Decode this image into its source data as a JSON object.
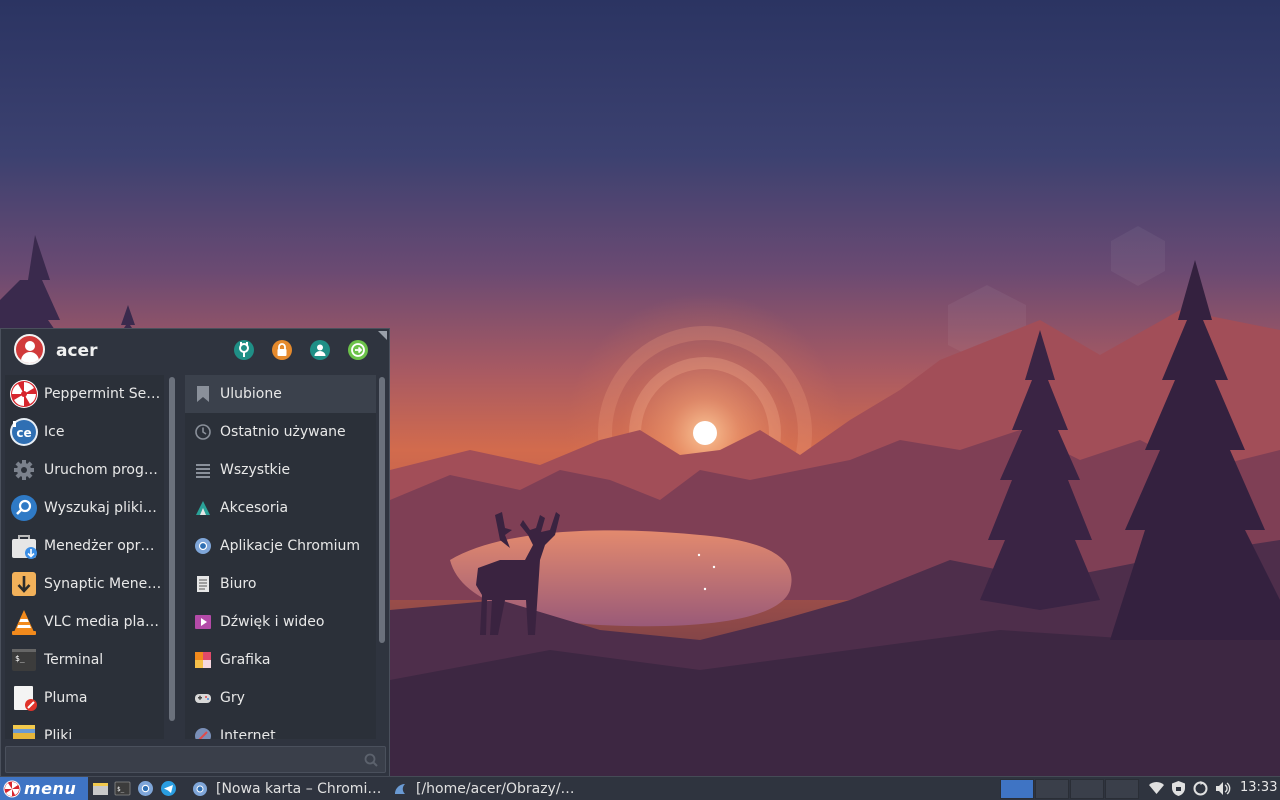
{
  "user": {
    "name": "acer"
  },
  "header_buttons": [
    {
      "name": "settings",
      "icon": "control-center-icon",
      "color": "#2aa198"
    },
    {
      "name": "lock",
      "icon": "lock-icon",
      "color": "#e58a2d"
    },
    {
      "name": "user-switch",
      "icon": "user-switch-icon",
      "color": "#2aa198"
    },
    {
      "name": "logout",
      "icon": "logout-icon",
      "color": "#6cc24a"
    }
  ],
  "favorites": [
    {
      "label": "Peppermint Se…",
      "icon": "peppermint-icon"
    },
    {
      "label": "Ice",
      "icon": "ice-icon"
    },
    {
      "label": "Uruchom prog…",
      "icon": "gear-icon"
    },
    {
      "label": "Wyszukaj pliki…",
      "icon": "search-files-icon"
    },
    {
      "label": "Menedżer opr…",
      "icon": "software-manager-icon"
    },
    {
      "label": "Synaptic Mene…",
      "icon": "synaptic-icon"
    },
    {
      "label": "VLC media player",
      "icon": "vlc-icon"
    },
    {
      "label": "Terminal",
      "icon": "terminal-icon"
    },
    {
      "label": "Pluma",
      "icon": "text-editor-icon"
    },
    {
      "label": "Pliki",
      "icon": "file-manager-icon"
    }
  ],
  "categories": [
    {
      "label": "Ulubione",
      "icon": "bookmark-icon",
      "selected": true
    },
    {
      "label": "Ostatnio używane",
      "icon": "clock-icon",
      "selected": false
    },
    {
      "label": "Wszystkie",
      "icon": "list-icon",
      "selected": false
    },
    {
      "label": "Akcesoria",
      "icon": "accessories-icon",
      "selected": false
    },
    {
      "label": "Aplikacje Chromium",
      "icon": "chromium-icon",
      "selected": false
    },
    {
      "label": "Biuro",
      "icon": "office-icon",
      "selected": false
    },
    {
      "label": "Dźwięk i wideo",
      "icon": "multimedia-icon",
      "selected": false
    },
    {
      "label": "Grafika",
      "icon": "graphics-icon",
      "selected": false
    },
    {
      "label": "Gry",
      "icon": "games-icon",
      "selected": false
    },
    {
      "label": "Internet",
      "icon": "internet-icon",
      "selected": false
    }
  ],
  "search": {
    "placeholder": "",
    "value": ""
  },
  "taskbar": {
    "menu_label": "menu",
    "launchers": [
      "file-manager-icon",
      "terminal-icon",
      "chromium-icon",
      "telegram-icon"
    ],
    "tasks": [
      {
        "label": "[Nowa karta – Chromi…",
        "icon": "chromium-icon"
      },
      {
        "label": "[/home/acer/Obrazy/…",
        "icon": "file-manager-icon"
      }
    ],
    "workspaces": 4,
    "active_workspace": 1,
    "tray": [
      "network-icon",
      "shield-icon",
      "update-icon",
      "volume-icon"
    ],
    "clock": "13:33"
  },
  "colors": {
    "panel": "#2f343f",
    "accent": "#3f74c4"
  }
}
